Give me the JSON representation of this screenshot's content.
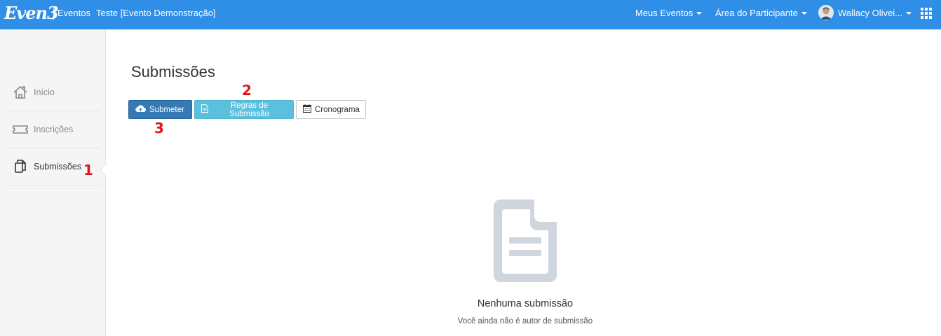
{
  "navbar": {
    "brand": "Even3",
    "eventos_label": "Eventos",
    "event_name": "Teste [Evento Demonstração]",
    "meus_eventos": "Meus Eventos",
    "area_participante": "Área do Participante",
    "user_name": "Wallacy Olivei...",
    "color": "#2f8ee5"
  },
  "sidebar": {
    "items": [
      {
        "label": "Início",
        "icon": "home-icon"
      },
      {
        "label": "Inscrições",
        "icon": "ticket-icon"
      },
      {
        "label": "Submissões",
        "icon": "copy-documents-icon",
        "active": true
      }
    ]
  },
  "main": {
    "title": "Submissões",
    "buttons": {
      "submeter": "Submeter",
      "regras": "Regras de Submissão",
      "cronograma": "Cronograma"
    },
    "empty_state": {
      "title": "Nenhuma submissão",
      "subtitle": "Você ainda não é autor de submissão",
      "icon": "document-icon"
    }
  },
  "annotations": {
    "marker_1": "1",
    "marker_2": "2",
    "marker_3": "3"
  }
}
